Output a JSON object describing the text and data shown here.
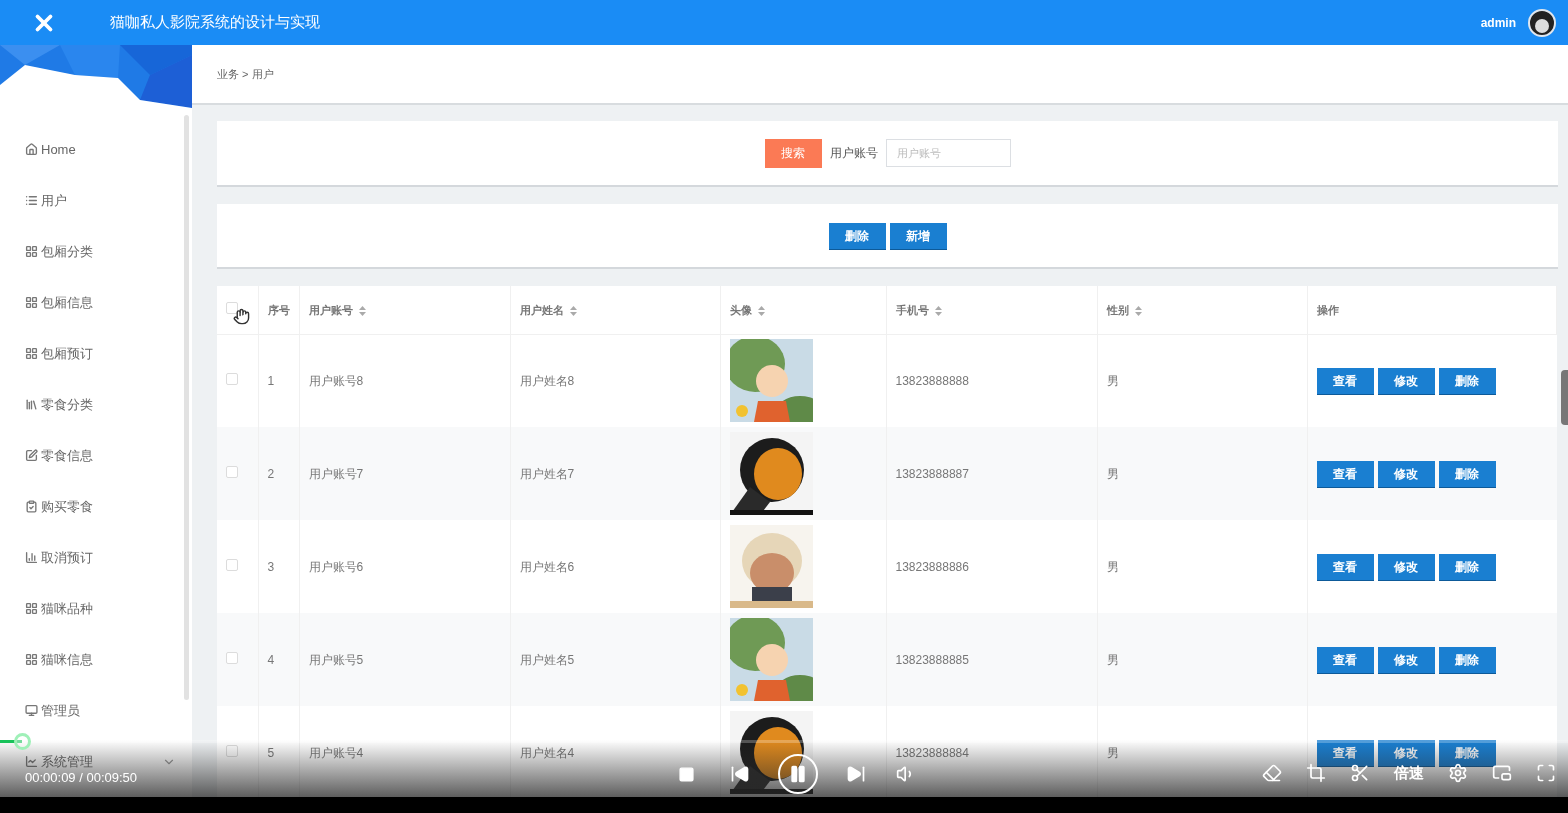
{
  "header": {
    "title": "猫咖私人影院系统的设计与实现",
    "user": "admin"
  },
  "sidebar": {
    "items": [
      {
        "label": "Home",
        "kind": "home"
      },
      {
        "label": "用户",
        "kind": "list"
      },
      {
        "label": "包厢分类",
        "kind": "grid"
      },
      {
        "label": "包厢信息",
        "kind": "grid"
      },
      {
        "label": "包厢预订",
        "kind": "grid"
      },
      {
        "label": "零食分类",
        "kind": "book"
      },
      {
        "label": "零食信息",
        "kind": "edit"
      },
      {
        "label": "购买零食",
        "kind": "clipboard"
      },
      {
        "label": "取消预订",
        "kind": "bars"
      },
      {
        "label": "猫咪品种",
        "kind": "grid"
      },
      {
        "label": "猫咪信息",
        "kind": "grid"
      },
      {
        "label": "管理员",
        "kind": "monitor"
      },
      {
        "label": "系统管理",
        "kind": "group"
      }
    ]
  },
  "breadcrumb": "业务 > 用户",
  "search": {
    "button": "搜索",
    "label": "用户账号",
    "placeholder": "用户账号"
  },
  "actions": [
    "删除",
    "新增"
  ],
  "table": {
    "header_checked": false,
    "columns": [
      {
        "label": "序号",
        "sortable": false
      },
      {
        "label": "用户账号",
        "sortable": true
      },
      {
        "label": "用户姓名",
        "sortable": true
      },
      {
        "label": "头像",
        "sortable": true
      },
      {
        "label": "手机号",
        "sortable": true
      },
      {
        "label": "性别",
        "sortable": true
      },
      {
        "label": "操作",
        "sortable": false
      }
    ],
    "rows": [
      {
        "checked": false,
        "no": "1",
        "account": "用户账号8",
        "name": "用户姓名8",
        "phone": "13823888888",
        "gender": "男",
        "buttons": [
          "查看",
          "修改",
          "删除"
        ]
      },
      {
        "checked": false,
        "no": "2",
        "account": "用户账号7",
        "name": "用户姓名7",
        "phone": "13823888887",
        "gender": "男",
        "buttons": [
          "查看",
          "修改",
          "删除"
        ]
      },
      {
        "checked": false,
        "no": "3",
        "account": "用户账号6",
        "name": "用户姓名6",
        "phone": "13823888886",
        "gender": "男",
        "buttons": [
          "查看",
          "修改",
          "删除"
        ]
      },
      {
        "checked": false,
        "no": "4",
        "account": "用户账号5",
        "name": "用户姓名5",
        "phone": "13823888885",
        "gender": "男",
        "buttons": [
          "查看",
          "修改",
          "删除"
        ]
      },
      {
        "checked": false,
        "no": "5",
        "account": "用户账号4",
        "name": "用户姓名4",
        "phone": "13823888884",
        "gender": "男",
        "buttons": [
          "查看",
          "修改",
          "删除"
        ]
      }
    ]
  },
  "player": {
    "time": "00:00:09 / 00:09:50",
    "playing": true,
    "speed": "倍速"
  }
}
